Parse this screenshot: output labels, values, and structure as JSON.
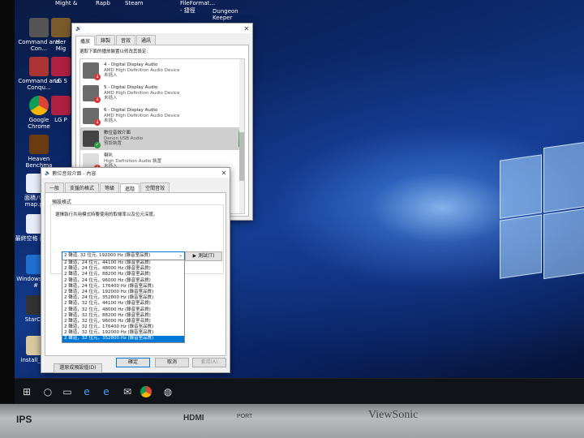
{
  "desktop": {
    "top_labels": [
      "Might &",
      "Rapb",
      "Steam",
      "FileFormat... - 捷徑",
      "Dungeon Keeper"
    ],
    "icons": [
      {
        "label": "Command and Con...",
        "icon": "command-conquer-icon"
      },
      {
        "label": "Her Mig",
        "icon": "heroes-icon"
      },
      {
        "label": "Command and Conqu...",
        "icon": "command-conquer-3-icon"
      },
      {
        "label": "LG S",
        "icon": "lg-icon"
      },
      {
        "label": "Google Chrome",
        "icon": "chrome-icon"
      },
      {
        "label": "LG P",
        "icon": "lg-icon"
      },
      {
        "label": "Heaven Benchma",
        "icon": "heaven-benchmark-icon"
      },
      {
        "label": "面積八種 map.pd",
        "icon": "pdf-icon"
      },
      {
        "label": "最終空格 面.pdf",
        "icon": "pdf-icon"
      },
      {
        "label": "Windows 外觀#",
        "icon": "windows-icon"
      },
      {
        "label": "StarCra",
        "icon": "starcraft-icon"
      },
      {
        "label": "install_usb",
        "icon": "usb-installer-icon"
      }
    ]
  },
  "sound_dialog": {
    "tabs": [
      "播放",
      "錄製",
      "音效",
      "通訊"
    ],
    "instruction": "選取下面的播放裝置以修改其設定:",
    "devices": [
      {
        "name": "4 - Digital Display Audio",
        "driver": "AMD High Definition Audio Device",
        "status": "未插入"
      },
      {
        "name": "5 - Digital Display Audio",
        "driver": "AMD High Definition Audio Device",
        "status": "未插入"
      },
      {
        "name": "6 - Digital Display Audio",
        "driver": "AMD High Definition Audio Device",
        "status": "未插入"
      },
      {
        "name": "數位音效介面",
        "driver": "Denon USB Audio",
        "status": "預設裝置"
      },
      {
        "name": "喇叭",
        "driver": "High Definition Audio 裝置",
        "status": "未插入"
      }
    ]
  },
  "props_dialog": {
    "title": "數位音效介面 - 內容",
    "tabs": [
      "一般",
      "支援的格式",
      "等級",
      "進階",
      "空間音效"
    ],
    "group_label": "預設格式",
    "description": "選擇執行共用模式時要使用的取樣率以及位元深度。",
    "selected_format": "2 聲道, 32 位元, 192000 Hz (錄音室品質)",
    "test_button": "▶ 測試(T)",
    "options": [
      "2 聲道，24 位元，44100 Hz (錄音室品質)",
      "2 聲道，24 位元，48000 Hz (錄音室品質)",
      "2 聲道，24 位元，88200 Hz (錄音室品質)",
      "2 聲道，24 位元，96000 Hz (錄音室品質)",
      "2 聲道，24 位元，176400 Hz (錄音室品質)",
      "2 聲道，24 位元，192000 Hz (錄音室品質)",
      "2 聲道，24 位元，352800 Hz (錄音室品質)",
      "2 聲道，32 位元，44100 Hz (錄音室品質)",
      "2 聲道，32 位元，48000 Hz (錄音室品質)",
      "2 聲道，32 位元，88200 Hz (錄音室品質)",
      "2 聲道，32 位元，96000 Hz (錄音室品質)",
      "2 聲道，32 位元，176400 Hz (錄音室品質)",
      "2 聲道，32 位元，192000 Hz (錄音室品質)",
      "2 聲道，32 位元，352800 Hz (錄音室品質)"
    ],
    "selected_index": 13,
    "restore_button": "還原成預設值(D)",
    "ok": "確定",
    "cancel": "取消",
    "apply": "套用(A)"
  },
  "monitor": {
    "brand": "ViewSonic",
    "badges": [
      "IPS",
      "HDMI",
      "PORT"
    ]
  }
}
